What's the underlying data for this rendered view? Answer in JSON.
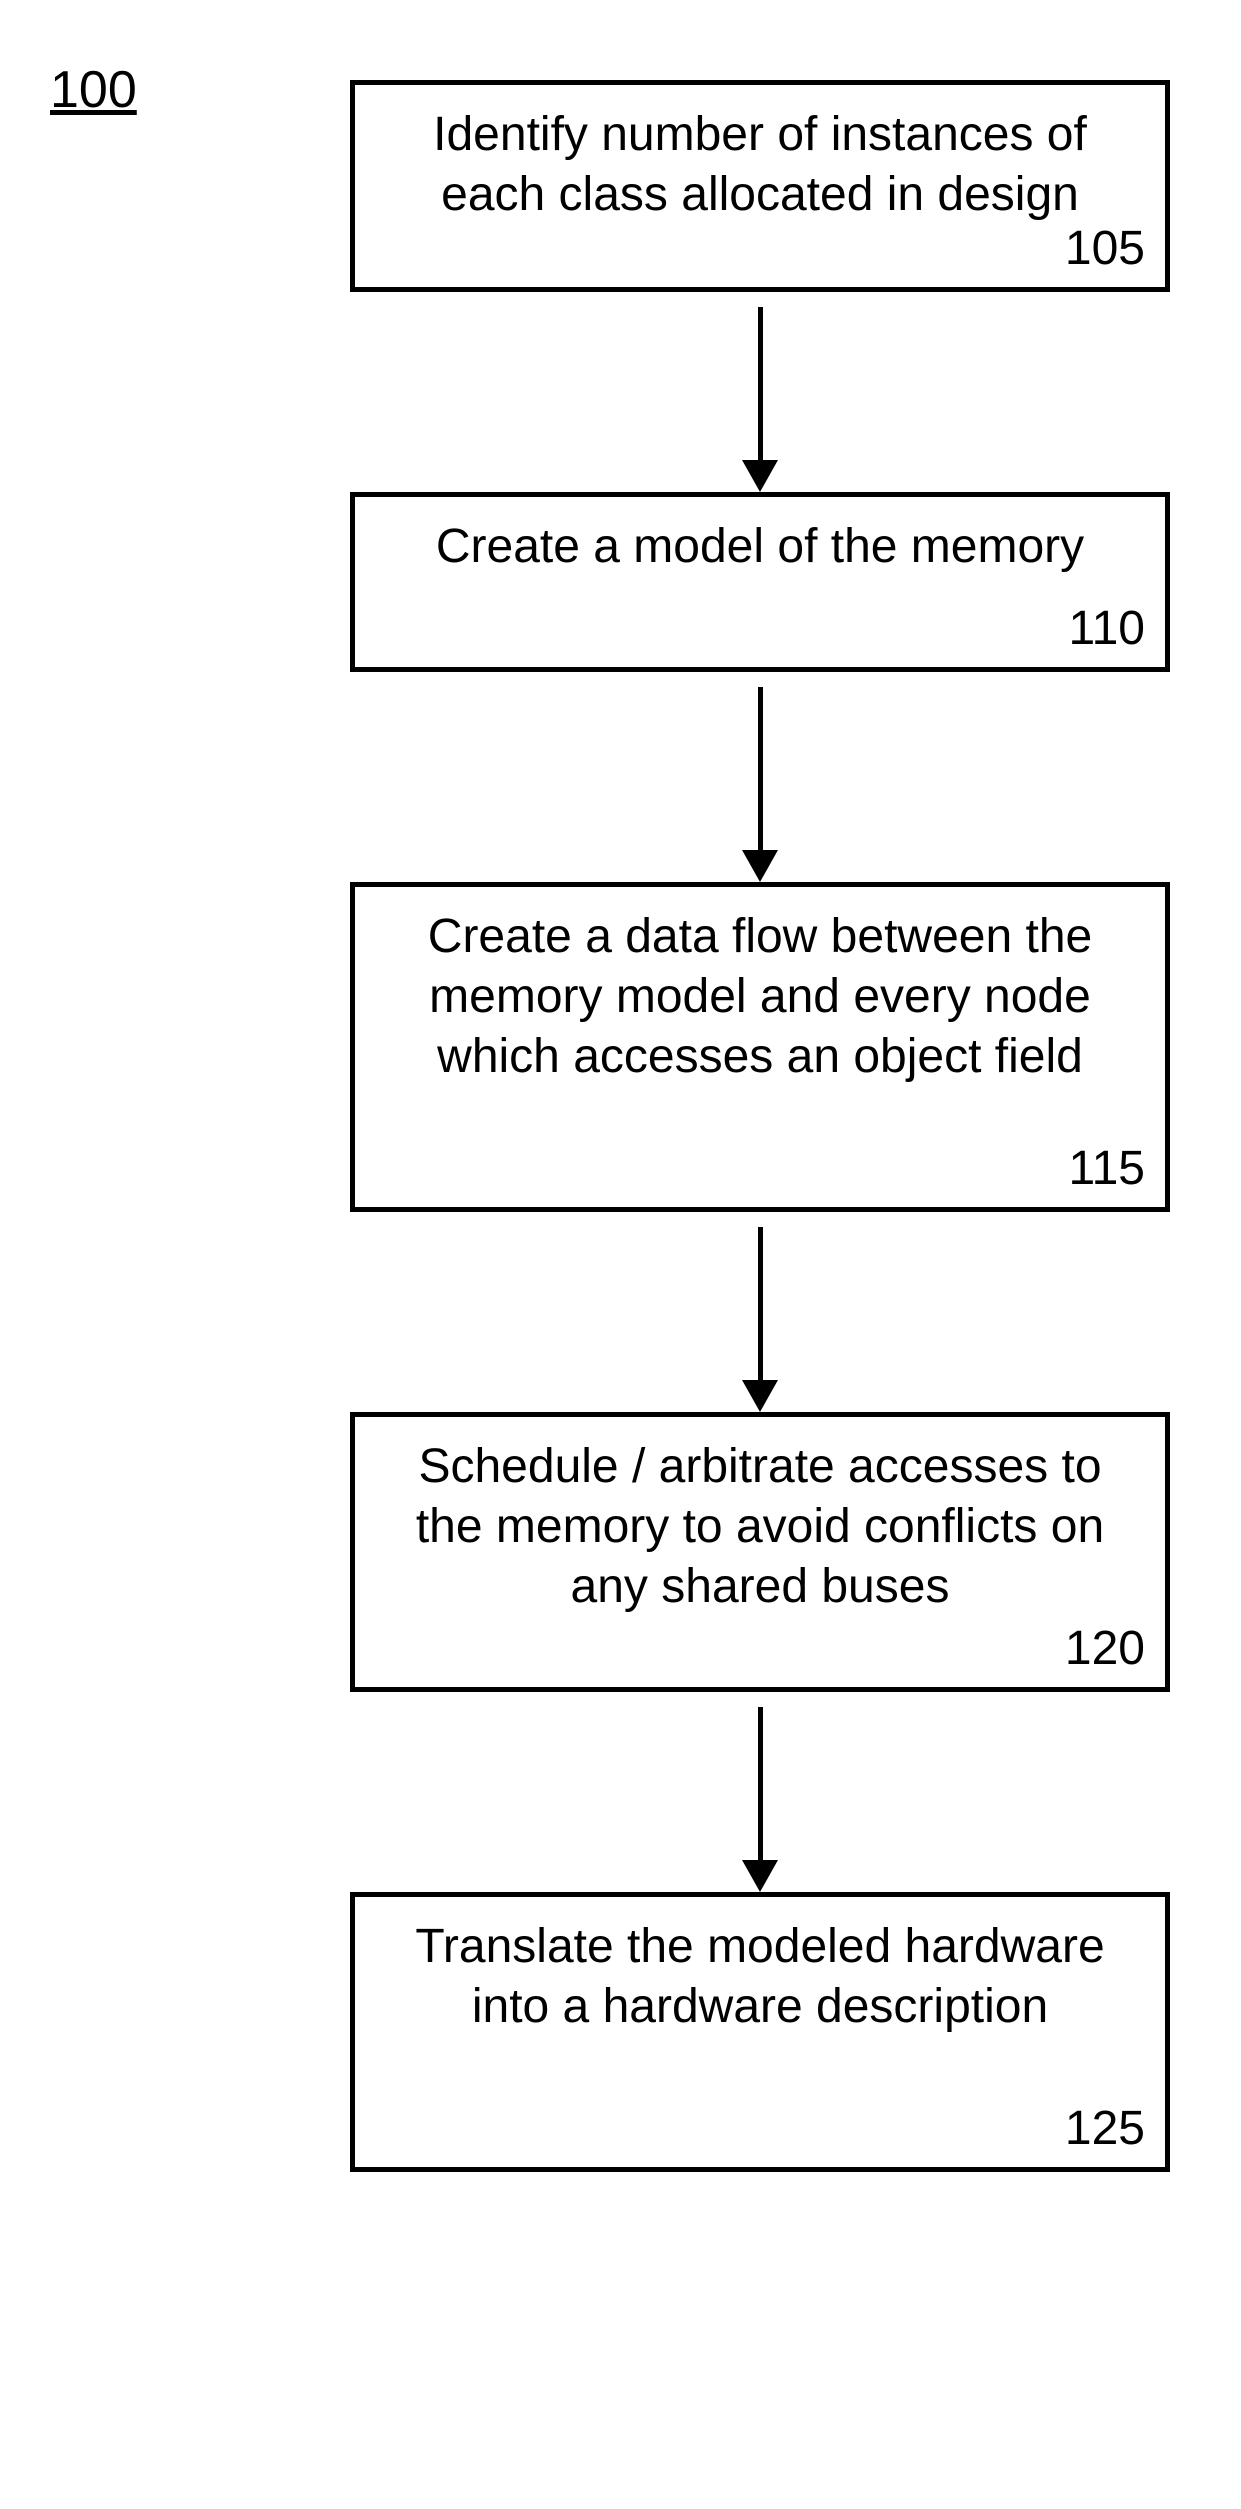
{
  "diagram": {
    "label": "100",
    "steps": [
      {
        "text": "Identify number of instances of each class allocated in design",
        "number": "105"
      },
      {
        "text": "Create a model of the memory",
        "number": "110"
      },
      {
        "text": "Create a data flow between the memory model and every node which accesses an object field",
        "number": "115"
      },
      {
        "text": "Schedule / arbitrate accesses to the memory to avoid conflicts on any shared buses",
        "number": "120"
      },
      {
        "text": "Translate the modeled hardware into a hardware description",
        "number": "125"
      }
    ]
  }
}
